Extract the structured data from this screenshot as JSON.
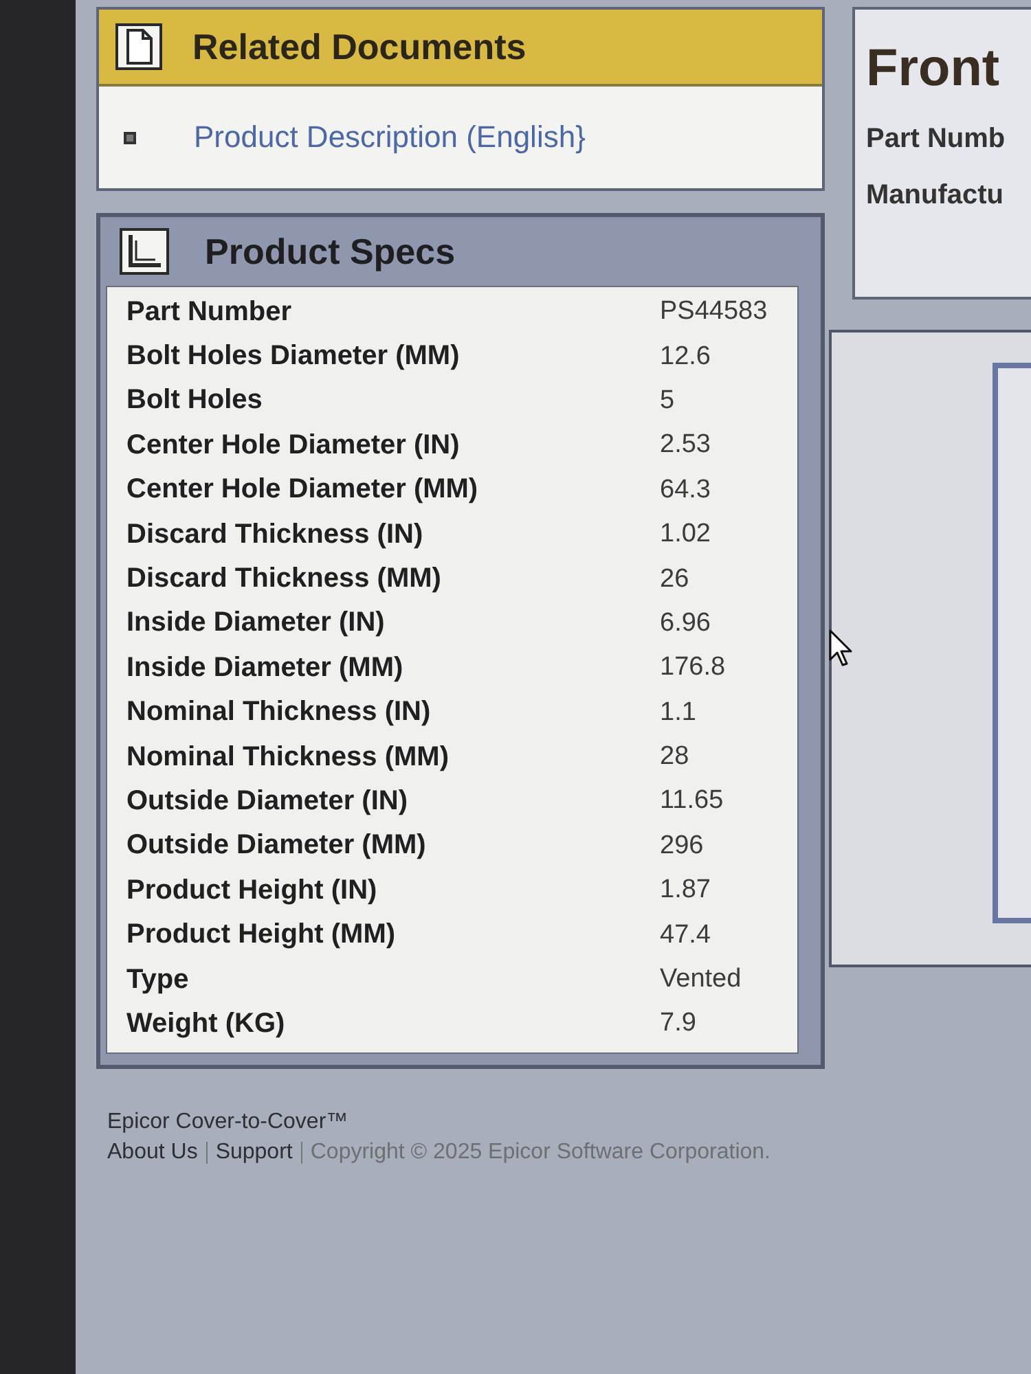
{
  "related_documents": {
    "title": "Related Documents",
    "links": [
      "Product Description (English}"
    ]
  },
  "product_specs": {
    "title": "Product Specs",
    "rows": [
      {
        "label": "Part Number",
        "value": "PS44583"
      },
      {
        "label": "Bolt Holes Diameter (MM)",
        "value": "12.6"
      },
      {
        "label": "Bolt Holes",
        "value": "5"
      },
      {
        "label": "Center Hole Diameter (IN)",
        "value": "2.53"
      },
      {
        "label": "Center Hole Diameter (MM)",
        "value": "64.3"
      },
      {
        "label": "Discard Thickness (IN)",
        "value": "1.02"
      },
      {
        "label": "Discard Thickness (MM)",
        "value": "26"
      },
      {
        "label": "Inside Diameter (IN)",
        "value": "6.96"
      },
      {
        "label": "Inside Diameter (MM)",
        "value": "176.8"
      },
      {
        "label": "Nominal Thickness (IN)",
        "value": "1.1"
      },
      {
        "label": "Nominal Thickness (MM)",
        "value": "28"
      },
      {
        "label": "Outside Diameter (IN)",
        "value": "11.65"
      },
      {
        "label": "Outside Diameter (MM)",
        "value": "296"
      },
      {
        "label": "Product Height (IN)",
        "value": "1.87"
      },
      {
        "label": "Product Height (MM)",
        "value": "47.4"
      },
      {
        "label": "Type",
        "value": "Vented"
      },
      {
        "label": "Weight (KG)",
        "value": "7.9"
      }
    ]
  },
  "front_panel": {
    "title": "Front",
    "fields": [
      "Part Numb",
      "Manufactu"
    ]
  },
  "footer": {
    "brand": "Epicor Cover-to-Cover™",
    "links": [
      "About Us",
      "Support"
    ],
    "copyright": "Copyright © 2025 Epicor Software Corporation."
  }
}
